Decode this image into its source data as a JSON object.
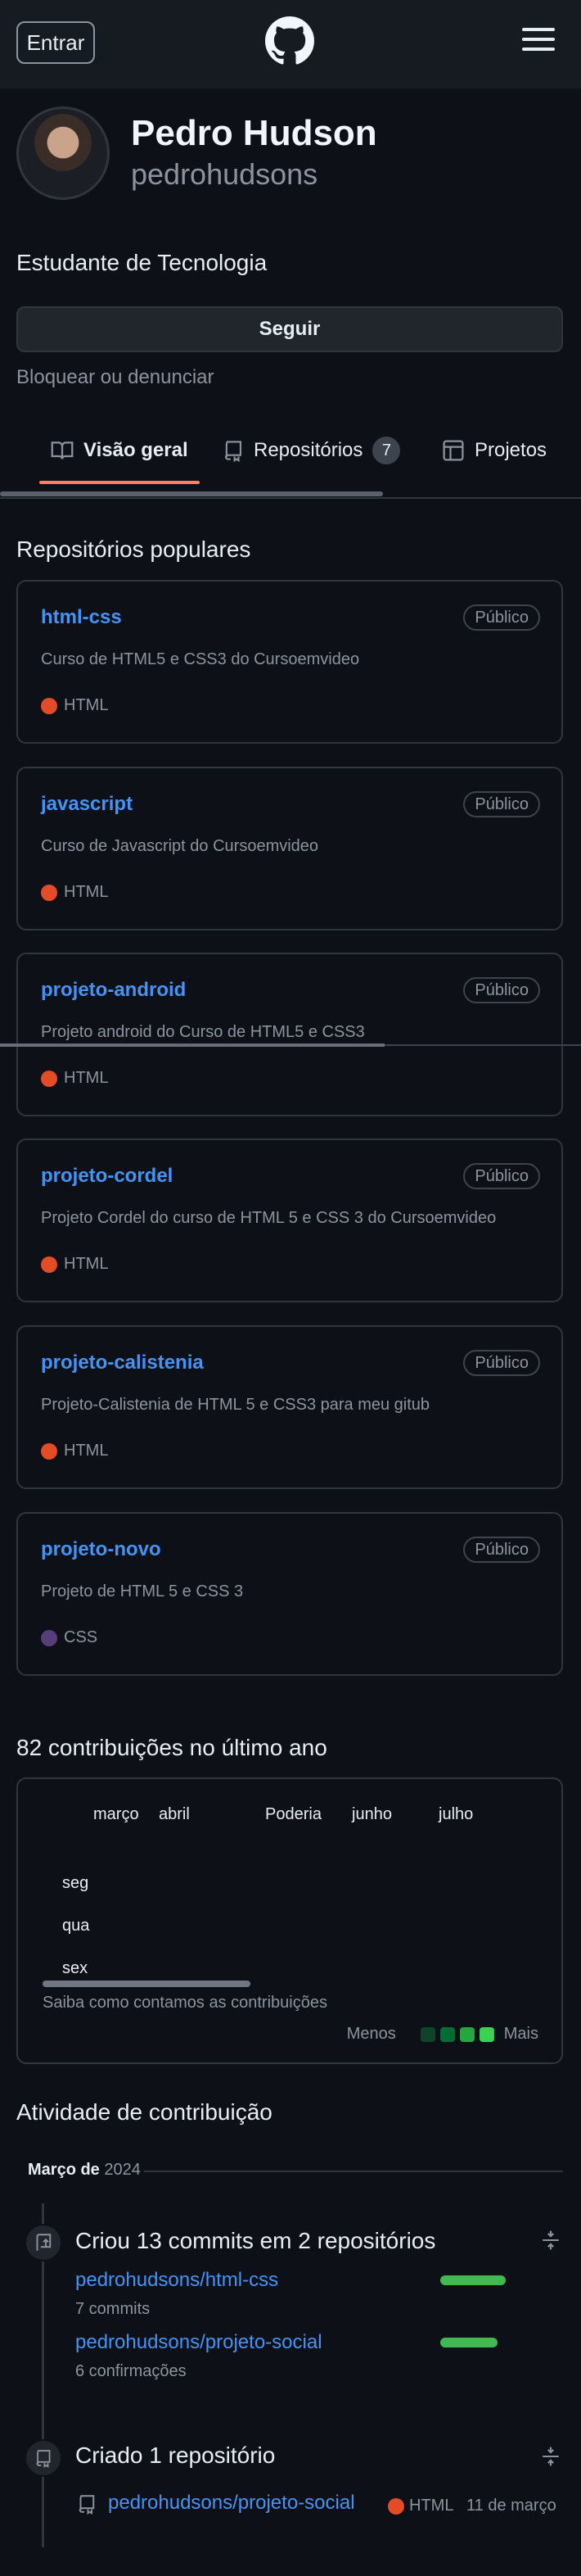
{
  "header": {
    "signin_label": "Entrar",
    "logo_icon": "github-mark-icon",
    "menu_icon": "hamburger-menu-icon"
  },
  "profile": {
    "name": "Pedro Hudson",
    "login": "pedrohudsons",
    "bio": "Estudante de Tecnologia",
    "follow_label": "Seguir",
    "block_label": "Bloquear ou denunciar"
  },
  "tabs": [
    {
      "label": "Visão geral",
      "icon": "book-icon",
      "active": true
    },
    {
      "label": "Repositórios",
      "icon": "repo-icon",
      "count": "7"
    },
    {
      "label": "Projetos",
      "icon": "table-icon"
    }
  ],
  "popular": {
    "title": "Repositórios populares",
    "repos": [
      {
        "name": "html-css",
        "visibility": "Público",
        "description": "Curso de HTML5 e CSS3 do Cursoemvideo",
        "language": "HTML",
        "lang_color": "#e34c26"
      },
      {
        "name": "javascript",
        "visibility": "Público",
        "description": "Curso de Javascript do Cursoemvideo",
        "language": "HTML",
        "lang_color": "#e34c26"
      },
      {
        "name": "projeto-android",
        "visibility": "Público",
        "description": "Projeto android do Curso de HTML5 e CSS3",
        "language": "HTML",
        "lang_color": "#e34c26"
      },
      {
        "name": "projeto-cordel",
        "visibility": "Público",
        "description": "Projeto Cordel do curso de HTML 5 e CSS 3 do Cursoemvideo",
        "language": "HTML",
        "lang_color": "#e34c26"
      },
      {
        "name": "projeto-calistenia",
        "visibility": "Público",
        "description": "Projeto-Calistenia de HTML 5 e CSS3 para meu gitub",
        "language": "HTML",
        "lang_color": "#e34c26"
      },
      {
        "name": "projeto-novo",
        "visibility": "Público",
        "description": "Projeto de HTML 5 e CSS 3",
        "language": "CSS",
        "lang_color": "#563d7c"
      }
    ]
  },
  "contributions": {
    "title": "82 contribuições no último ano",
    "months": [
      "março",
      "abril",
      "Poderia",
      "junho",
      "julho"
    ],
    "days": [
      "seg",
      "qua",
      "sex"
    ],
    "help_text": "Saiba como contamos as contribuições",
    "legend_less": "Menos",
    "legend_more": "Mais",
    "legend_colors": [
      "#0e4429",
      "#006d32",
      "#26a641",
      "#39d353"
    ]
  },
  "activity": {
    "title": "Atividade de contribuição",
    "month": "Março de",
    "year": "2024",
    "items": [
      {
        "icon": "repo-push-icon",
        "title": "Criou 13 commits em 2 repositórios",
        "repos": [
          {
            "name": "pedrohudsons/html-css",
            "sub": "7 commits",
            "share": 0.8
          },
          {
            "name": "pedrohudsons/projeto-social",
            "sub": "6 confirmações",
            "share": 0.7
          }
        ]
      },
      {
        "icon": "repo-icon",
        "title": "Criado 1 repositório",
        "repo": "pedrohudsons/projeto-social",
        "language": "HTML",
        "lang_color": "#e34c26",
        "date": "11 de março"
      }
    ]
  }
}
